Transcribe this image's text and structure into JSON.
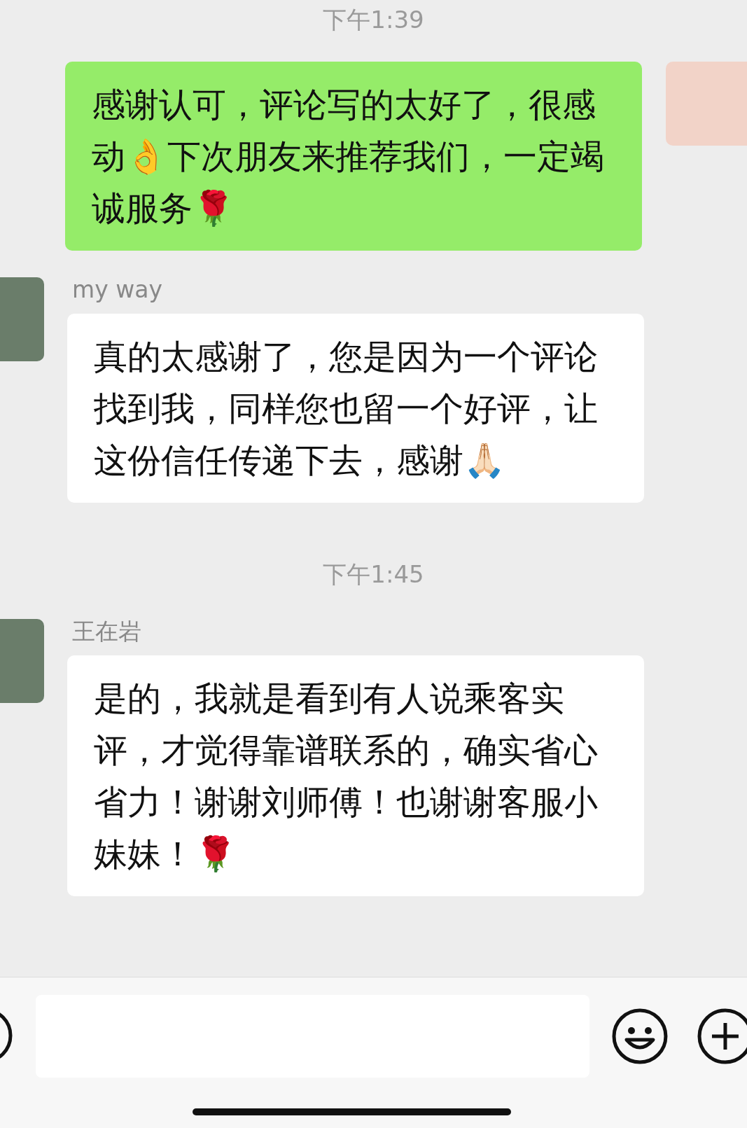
{
  "messages": [
    {
      "kind": "time",
      "text": "下午1:39"
    },
    {
      "kind": "sent",
      "text": "感谢认可，评论写的太好了，很感动👌下次朋友来推荐我们，一定竭诚服务🌹"
    },
    {
      "kind": "received",
      "sender": "my way",
      "text": "真的太感谢了，您是因为一个评论找到我，同样您也留一个好评，让这份信任传递下去，感谢🙏🏻"
    },
    {
      "kind": "time",
      "text": "下午1:45"
    },
    {
      "kind": "received",
      "sender": "王在岩",
      "text": "是的，我就是看到有人说乘客实评，才觉得靠谱联系的，确实省心省力！谢谢刘师傅！也谢谢客服小妹妹！🌹"
    }
  ]
}
